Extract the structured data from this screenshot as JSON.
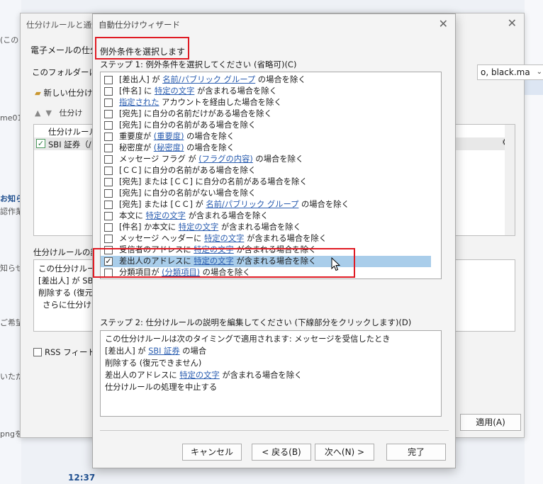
{
  "background": {
    "left_texts": [
      "(この",
      "me01/",
      "お知ら",
      "認作業",
      "知らせ",
      "ご希望",
      "いただ",
      "pngを"
    ],
    "time": "12:37"
  },
  "rules_dialog": {
    "title": "仕分けルールと通知",
    "tab": "電子メールの仕分",
    "folder_label": "このフォルダーに変",
    "email_select": "o, black.ma",
    "new_rule_button": "新しい仕分け",
    "nav_label": "仕分け",
    "list_header": "仕分けルール",
    "rule_row": "SBI 証券（/",
    "desc_label": "仕分けルールの説",
    "desc_lines": [
      "この仕分けルー",
      "[差出人] が SB",
      "削除する (復元",
      "さらに仕分けル"
    ],
    "rss_label": "RSS フィードが",
    "apply_button": "適用(A)"
  },
  "wizard": {
    "title": "自動仕分けウィザード",
    "section_title": "例外条件を選択します",
    "step1_label": "ステップ 1: 例外条件を選択してください (省略可)(C)",
    "conditions": [
      {
        "pre": "[差出人] が ",
        "link": "名前/パブリック グループ",
        "post": " の場合を除く",
        "checked": false
      },
      {
        "pre": "[件名] に ",
        "link": "特定の文字",
        "post": " が含まれる場合を除く",
        "checked": false
      },
      {
        "pre": "",
        "link": "指定された",
        "post": " アカウントを経由した場合を除く",
        "checked": false
      },
      {
        "pre": "[宛先] に自分の名前だけがある場合を除く",
        "link": "",
        "post": "",
        "checked": false
      },
      {
        "pre": "[宛先] に自分の名前がある場合を除く",
        "link": "",
        "post": "",
        "checked": false
      },
      {
        "pre": "重要度が ",
        "link": "(重要度)",
        "post": " の場合を除く",
        "checked": false
      },
      {
        "pre": "秘密度が ",
        "link": "(秘密度)",
        "post": " の場合を除く",
        "checked": false
      },
      {
        "pre": "メッセージ フラグ が ",
        "link": "(フラグの内容)",
        "post": " の場合を除く",
        "checked": false
      },
      {
        "pre": "[ＣＣ] に自分の名前がある場合を除く",
        "link": "",
        "post": "",
        "checked": false
      },
      {
        "pre": "[宛先] または [ＣＣ] に自分の名前がある場合を除く",
        "link": "",
        "post": "",
        "checked": false
      },
      {
        "pre": "[宛先] に自分の名前がない場合を除く",
        "link": "",
        "post": "",
        "checked": false
      },
      {
        "pre": "[宛先] または [ＣＣ] が ",
        "link": "名前/パブリック グループ",
        "post": " の場合を除く",
        "checked": false
      },
      {
        "pre": "本文に ",
        "link": "特定の文字",
        "post": " が含まれる場合を除く",
        "checked": false
      },
      {
        "pre": "[件名] か本文に ",
        "link": "特定の文字",
        "post": " が含まれる場合を除く",
        "checked": false
      },
      {
        "pre": "メッセージ ヘッダーに ",
        "link": "特定の文字",
        "post": " が含まれる場合を除く",
        "checked": false
      },
      {
        "pre": "受信者のアドレスに ",
        "link": "特定の文字",
        "post": " が含まれる場合を除く",
        "checked": false
      },
      {
        "pre": "差出人のアドレスに ",
        "link": "特定の文字",
        "post": " が含まれる場合を除く",
        "checked": true
      },
      {
        "pre": "分類項目が ",
        "link": "(分類項目)",
        "post": " の場合を除く",
        "checked": false
      }
    ],
    "step2_label": "ステップ 2: 仕分けルールの説明を編集してください (下線部分をクリックします)(D)",
    "step2_lines": [
      {
        "pre": "この仕分けルールは次のタイミングで適用されます: メッセージを受信したとき",
        "link": "",
        "post": ""
      },
      {
        "pre": "[差出人] が ",
        "link": "SBI 証券",
        "post": " の場合"
      },
      {
        "pre": "削除する (復元できません)",
        "link": "",
        "post": ""
      },
      {
        "pre": "差出人のアドレスに ",
        "link": "特定の文字",
        "post": " が含まれる場合を除く"
      },
      {
        "pre": "仕分けルールの処理を中止する",
        "link": "",
        "post": ""
      }
    ],
    "buttons": {
      "cancel": "キャンセル",
      "back": "< 戻る(B)",
      "next": "次へ(N) >",
      "finish": "完了"
    }
  },
  "colors": {
    "highlight": "#e01b24",
    "selection": "#a9cdea",
    "link": "#2a5db0"
  }
}
